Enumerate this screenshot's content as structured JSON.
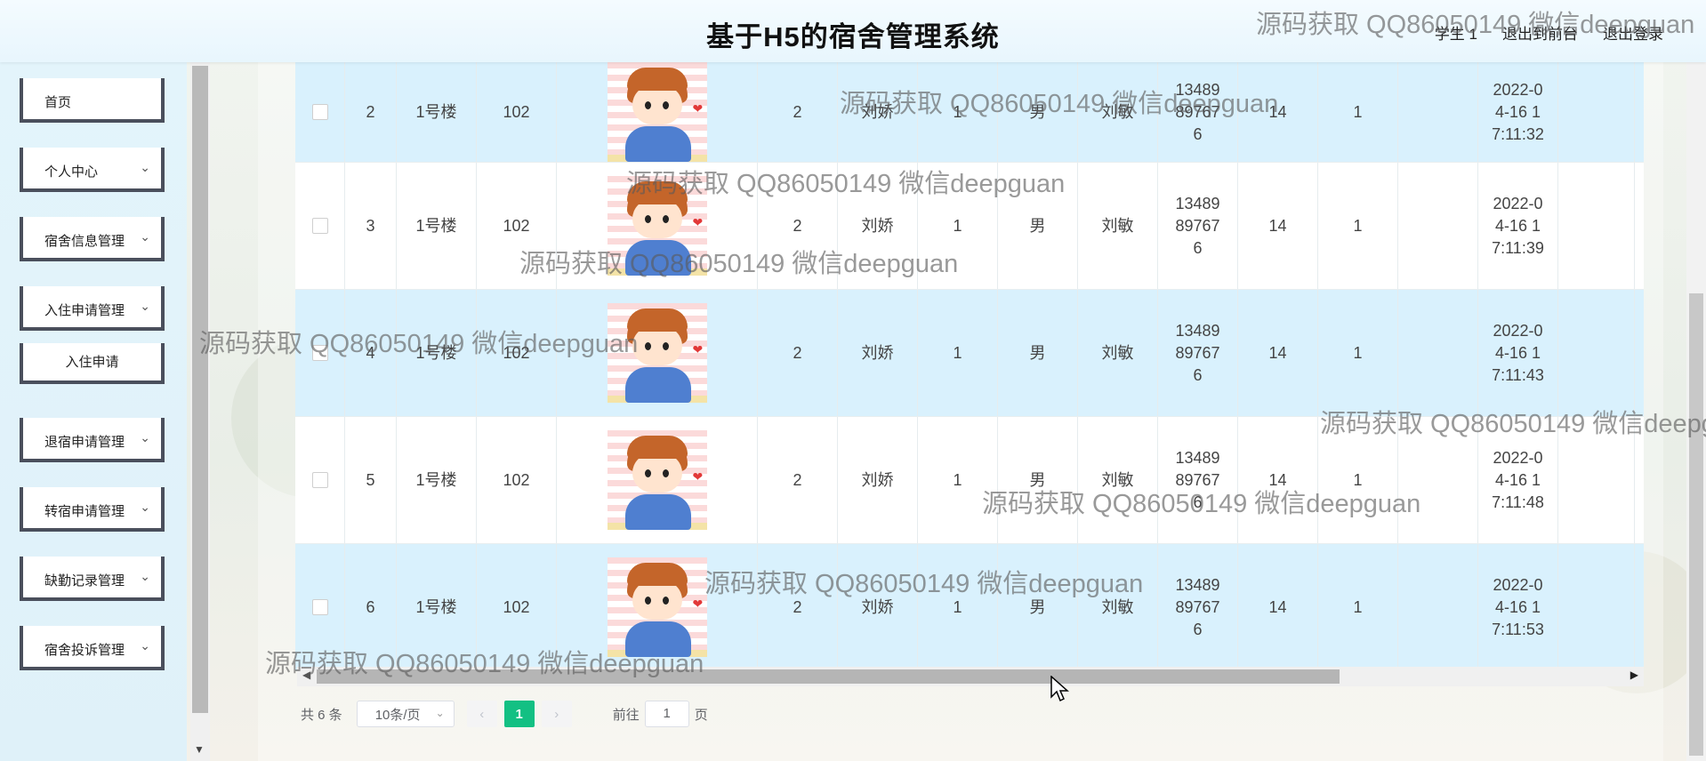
{
  "header": {
    "title": "基于H5的宿舍管理系统",
    "user_label": "学生 1",
    "to_front_label": "退出到前台",
    "logout_label": "退出登录"
  },
  "sidebar": {
    "items": [
      {
        "label": "首页",
        "expandable": false
      },
      {
        "label": "个人中心",
        "expandable": true
      },
      {
        "label": "宿舍信息管理",
        "expandable": true
      },
      {
        "label": "入住申请管理",
        "expandable": true,
        "sub": "入住申请"
      },
      {
        "label": "退宿申请管理",
        "expandable": true
      },
      {
        "label": "转宿申请管理",
        "expandable": true
      },
      {
        "label": "缺勤记录管理",
        "expandable": true
      },
      {
        "label": "宿舍投诉管理",
        "expandable": true
      }
    ]
  },
  "table": {
    "rows": [
      {
        "index": "2",
        "building": "1号楼",
        "room": "102",
        "beds": "2",
        "name": "刘娇",
        "num": "1",
        "gender": "男",
        "name2": "刘敏",
        "phone": "13489897676",
        "age": "14",
        "count": "1",
        "time": "2022-04-16 17:11:32"
      },
      {
        "index": "3",
        "building": "1号楼",
        "room": "102",
        "beds": "2",
        "name": "刘娇",
        "num": "1",
        "gender": "男",
        "name2": "刘敏",
        "phone": "13489897676",
        "age": "14",
        "count": "1",
        "time": "2022-04-16 17:11:39"
      },
      {
        "index": "4",
        "building": "1号楼",
        "room": "102",
        "beds": "2",
        "name": "刘娇",
        "num": "1",
        "gender": "男",
        "name2": "刘敏",
        "phone": "13489897676",
        "age": "14",
        "count": "1",
        "time": "2022-04-16 17:11:43"
      },
      {
        "index": "5",
        "building": "1号楼",
        "room": "102",
        "beds": "2",
        "name": "刘娇",
        "num": "1",
        "gender": "男",
        "name2": "刘敏",
        "phone": "13489897676",
        "age": "14",
        "count": "1",
        "time": "2022-04-16 17:11:48"
      },
      {
        "index": "6",
        "building": "1号楼",
        "room": "102",
        "beds": "2",
        "name": "刘娇",
        "num": "1",
        "gender": "男",
        "name2": "刘敏",
        "phone": "13489897676",
        "age": "14",
        "count": "1",
        "time": "2022-04-16 17:11:53"
      }
    ]
  },
  "pagination": {
    "total_label": "共 6 条",
    "page_size": "10条/页",
    "current_page": "1",
    "goto_label": "前往",
    "goto_value": "1",
    "page_unit": "页"
  },
  "watermark": "源码获取 QQ86050149 微信deepguan",
  "colors": {
    "row_highlight": "#d9f1fd",
    "active_page": "#13c083",
    "sidebar_border": "#4a4f5c"
  }
}
